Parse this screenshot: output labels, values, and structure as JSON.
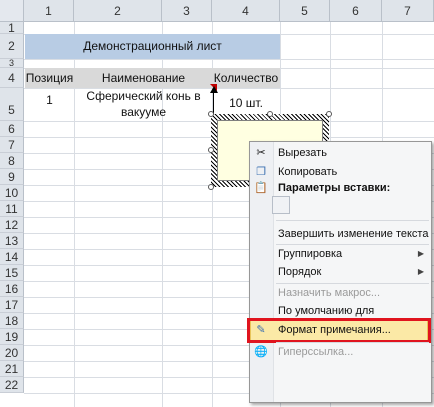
{
  "columns": [
    "1",
    "2",
    "3",
    "4",
    "5",
    "6",
    "7"
  ],
  "rows": [
    "1",
    "2",
    "3",
    "4",
    "5",
    "6",
    "7",
    "8",
    "9",
    "10",
    "11",
    "12",
    "13",
    "14",
    "15",
    "16",
    "17",
    "18",
    "19",
    "20",
    "21",
    "22"
  ],
  "banner": "Демонстрационный лист",
  "table": {
    "headers": [
      "Позиция",
      "Наименование",
      "Количество"
    ],
    "row": {
      "position": "1",
      "name_line1": "Сферический конь в",
      "name_line2": "вакууме",
      "quantity": "10 шт."
    }
  },
  "context_menu": {
    "cut": "Вырезать",
    "copy": "Копировать",
    "paste_options": "Параметры вставки:",
    "exit_edit": "Завершить изменение текста",
    "grouping": "Группировка",
    "order": "Порядок",
    "assign_macro": "Назначить макрос...",
    "default_autoshape": "По умолчанию для автофигур",
    "format_comment": "Формат примечания...",
    "hyperlink": "Гиперссылка..."
  },
  "colors": {
    "banner_bg": "#b8cce4",
    "header_bg": "#d9d9d9",
    "highlight_border": "#e0141e",
    "comment_bg": "#ffffe1"
  }
}
